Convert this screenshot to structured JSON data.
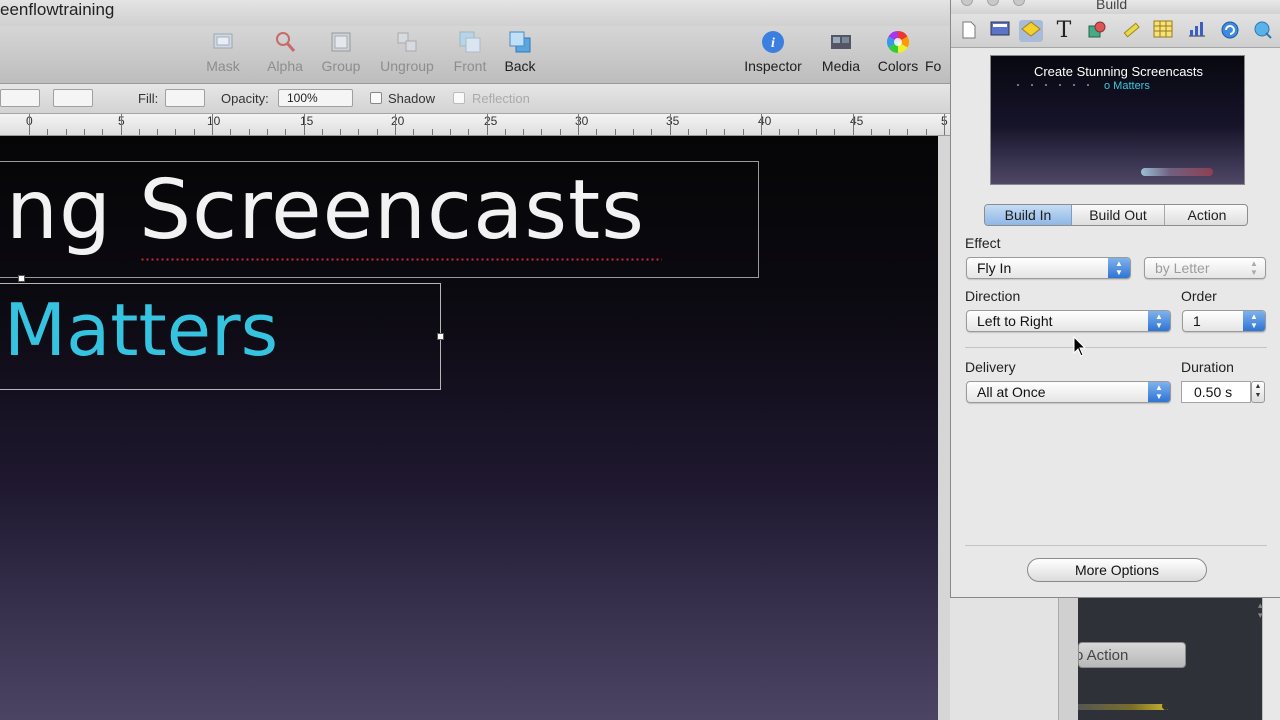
{
  "window": {
    "title": "eenflowtraining"
  },
  "toolbar": {
    "mask": "Mask",
    "alpha": "Alpha",
    "group": "Group",
    "ungroup": "Ungroup",
    "front": "Front",
    "back": "Back",
    "inspector": "Inspector",
    "media": "Media",
    "colors": "Colors",
    "fonts": "Fo"
  },
  "formatbar": {
    "fill_label": "Fill:",
    "opacity_label": "Opacity:",
    "opacity_value": "100%",
    "shadow_label": "Shadow",
    "reflection_label": "Reflection"
  },
  "ruler": {
    "marks": [
      "0",
      "5",
      "10",
      "15",
      "20",
      "25",
      "30",
      "35",
      "40",
      "45",
      "5"
    ]
  },
  "slide": {
    "title_text": "ng Screencasts",
    "subtitle_text": "Matters"
  },
  "panel": {
    "title": "Build",
    "preview": {
      "title": "Create Stunning Screencasts",
      "subtitle": "o Matters"
    },
    "tabs": {
      "build_in": "Build In",
      "build_out": "Build Out",
      "action": "Action",
      "active": "Build In"
    },
    "effect": {
      "label": "Effect",
      "value": "Fly In",
      "secondary_value": "by Letter"
    },
    "direction": {
      "label": "Direction",
      "value": "Left to Right"
    },
    "order": {
      "label": "Order",
      "value": "1"
    },
    "delivery": {
      "label": "Delivery",
      "value": "All at Once"
    },
    "duration": {
      "label": "Duration",
      "value": "0.50 s"
    },
    "more_options": "More Options"
  },
  "back_window": {
    "action_button": "o Action"
  },
  "colors": {
    "subtitle": "#35c3df",
    "title": "#f2f2f2",
    "selected_tab": "#8fb7e6"
  }
}
